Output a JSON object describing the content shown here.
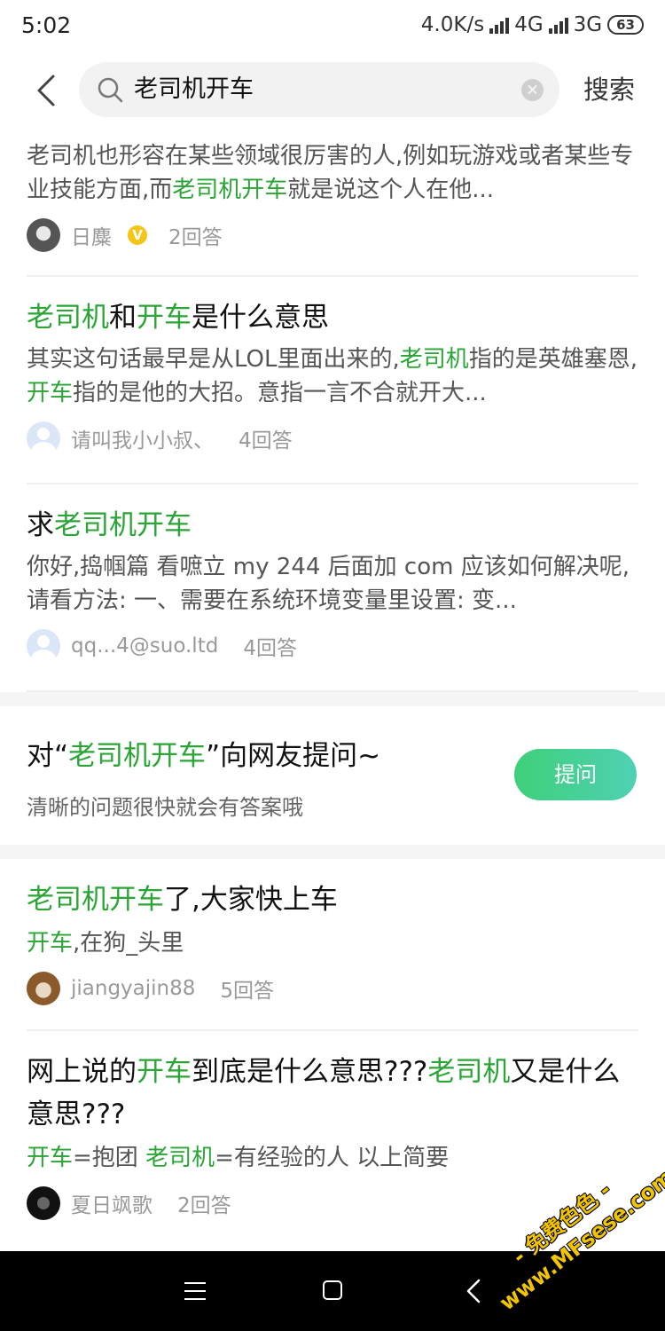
{
  "status_bar": {
    "time": "5:02",
    "net_speed": "4.0K/s",
    "net1": "4G",
    "net2": "3G",
    "battery": "63"
  },
  "search": {
    "query": "老司机开车",
    "button": "搜索"
  },
  "results_top": [
    {
      "snippet_parts": [
        {
          "t": "老司机也形容在某些领域很厉害的人,例如玩游戏或者某些专业技能方面,而",
          "hl": false
        },
        {
          "t": "老司机开车",
          "hl": true
        },
        {
          "t": "就是说这个人在他...",
          "hl": false
        }
      ],
      "author": "日麋",
      "verified": true,
      "answers": "2回答"
    },
    {
      "title_parts": [
        {
          "t": "老司机",
          "hl": true
        },
        {
          "t": "和",
          "hl": false
        },
        {
          "t": "开车",
          "hl": true
        },
        {
          "t": "是什么意思",
          "hl": false
        }
      ],
      "snippet_parts": [
        {
          "t": "其实这句话最早是从LOL里面出来的,",
          "hl": false
        },
        {
          "t": "老司机",
          "hl": true
        },
        {
          "t": "指的是英雄塞恩,",
          "hl": false
        },
        {
          "t": "开车",
          "hl": true
        },
        {
          "t": "指的是他的大招。意指一言不合就开大...",
          "hl": false
        }
      ],
      "author": "请叫我小小叔、",
      "answers": "4回答"
    },
    {
      "title_parts": [
        {
          "t": "求",
          "hl": false
        },
        {
          "t": "老司机开车",
          "hl": true
        }
      ],
      "snippet_parts": [
        {
          "t": "你好,捣帼篇 看嗻立 my 244 后面加 com 应该如何解决呢,请看方法: 一、需要在系统环境变量里设置: 变...",
          "hl": false
        }
      ],
      "author": "qq...4@suo.ltd",
      "answers": "4回答"
    }
  ],
  "ask": {
    "prefix": "对“",
    "keyword": "老司机开车",
    "suffix": "”向网友提问~",
    "subtitle": "清晰的问题很快就会有答案哦",
    "button": "提问"
  },
  "results_bottom": [
    {
      "title_parts": [
        {
          "t": "老司机开车",
          "hl": true
        },
        {
          "t": "了,大家快上车",
          "hl": false
        }
      ],
      "snippet_parts": [
        {
          "t": "开车",
          "hl": true
        },
        {
          "t": ",在狗_头里",
          "hl": false
        }
      ],
      "author": "jiangyajin88",
      "answers": "5回答"
    },
    {
      "title_parts": [
        {
          "t": "网上说的",
          "hl": false
        },
        {
          "t": "开车",
          "hl": true
        },
        {
          "t": "到底是什么意思???",
          "hl": false
        },
        {
          "t": "老司机",
          "hl": true
        },
        {
          "t": "又是什么意思???",
          "hl": false
        }
      ],
      "snippet_parts": [
        {
          "t": "开车",
          "hl": true
        },
        {
          "t": "=抱团 ",
          "hl": false
        },
        {
          "t": "老司机",
          "hl": true
        },
        {
          "t": "=有经验的人 以上简要",
          "hl": false
        }
      ],
      "author": "夏日飒歌",
      "answers": "2回答"
    }
  ],
  "watermark": {
    "line1": "- 免费色色 -",
    "line2": "www.MFsese.com"
  }
}
